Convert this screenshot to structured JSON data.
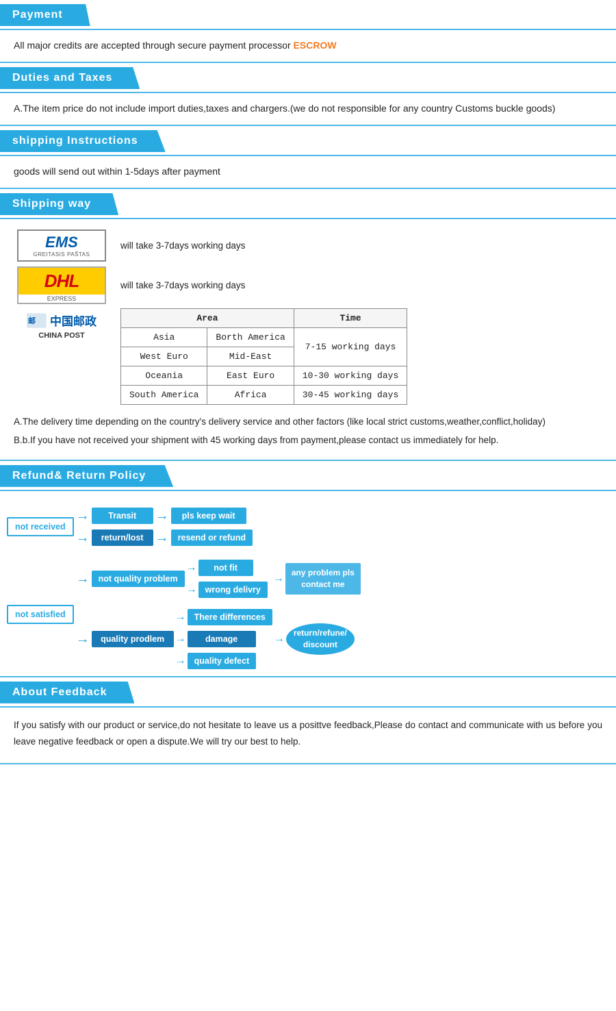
{
  "sections": {
    "payment": {
      "title": "Payment",
      "text": "All  major  credits  are  accepted  through  secure  payment  processor",
      "escrow": "ESCROW"
    },
    "duties": {
      "title": "Duties  and  Taxes",
      "text": "A.The  item  price  do  not  include  import  duties,taxes  and  chargers.(we  do  not  responsible  for  any  country  Customs  buckle  goods)"
    },
    "shipping_instructions": {
      "title": "shipping  Instructions",
      "text": "goods  will  send  out  within  1-5days  after  payment"
    },
    "shipping_way": {
      "title": "Shipping  way",
      "ems_label": "will  take  3-7days  working  days",
      "dhl_label": "will  take  3-7days  working  days",
      "table": {
        "headers": [
          "Area",
          "Time"
        ],
        "rows": [
          {
            "area1": "Asia",
            "area2": "Borth  America",
            "time": "7-15 working days"
          },
          {
            "area1": "West  Euro",
            "area2": "Mid-East",
            "time": "10-30 working days"
          },
          {
            "area1": "Oceania",
            "area2": "East  Euro",
            "time": ""
          },
          {
            "area1": "South  America",
            "area2": "Africa",
            "time": "30-45 working days"
          }
        ]
      },
      "note_a": "A.The  delivery  time  depending  on  the  country's  delivery  service  and  other  factors  (like  local  strict  customs,weather,conflict,holiday)",
      "note_b": "B.b.If  you  have  not  received  your  shipment  with  45  working  days  from  payment,please  contact  us  immediately  for  help."
    },
    "refund": {
      "title": "Refund&  Return  Policy",
      "not_received": "not  received",
      "transit": "Transit",
      "pls_keep_wait": "pls  keep  wait",
      "return_lost": "return/lost",
      "resend_refund": "resend  or  refund",
      "not_satisfied": "not  satisfied",
      "not_quality_problem": "not  quality  problem",
      "not_fit": "not  fit",
      "wrong_delivery": "wrong  delivry",
      "quality_problem": "quality  prodlem",
      "there_differences": "There  differences",
      "damage": "damage",
      "quality_defect": "quality  defect",
      "any_problem": "any  problem  pls  contact  me",
      "return_refune": "return/refune/ discount"
    },
    "feedback": {
      "title": "About  Feedback",
      "text": "If  you  satisfy  with  our  product  or  service,do  not  hesitate  to  leave  us  a  posittve  feedback,Please  do  contact  and  communicate  with  us  before  you  leave  negative  feedback  or  open  a  dispute.We  will  try  our  best  to  help."
    }
  }
}
